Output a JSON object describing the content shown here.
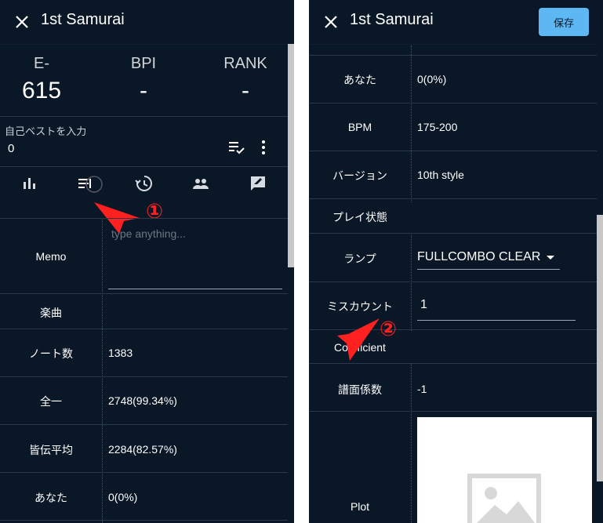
{
  "left": {
    "title": "1st Samurai",
    "stats": [
      {
        "label": "E-",
        "value": "615"
      },
      {
        "label": "BPI",
        "value": "-"
      },
      {
        "label": "RANK",
        "value": "-"
      }
    ],
    "best_label": "自己ベストを入力",
    "best_value": "0",
    "memo": {
      "label": "Memo",
      "placeholder": "type anything..."
    },
    "section": "楽曲",
    "rows": [
      {
        "label": "ノート数",
        "value": "1383"
      },
      {
        "label": "全一",
        "value": "2748(99.34%)"
      },
      {
        "label": "皆伝平均",
        "value": "2284(82.57%)"
      },
      {
        "label": "あなた",
        "value": "0(0%)"
      }
    ],
    "annotation": "①"
  },
  "right": {
    "title": "1st Samurai",
    "save_label": "保存",
    "rows": [
      {
        "label": "あなた",
        "value": "0(0%)"
      },
      {
        "label": "BPM",
        "value": "175-200"
      },
      {
        "label": "バージョン",
        "value": "10th style"
      }
    ],
    "section": "プレイ状態",
    "lamp": {
      "label": "ランプ",
      "value": "FULLCOMBO CLEAR"
    },
    "misscount": {
      "label": "ミスカウント",
      "value": "1"
    },
    "coefficient": "Coefficient",
    "fumen": {
      "label": "譜面係数",
      "value": "-1"
    },
    "plot": "Plot",
    "annotation": "②"
  },
  "colors": {
    "background": "#0a1726",
    "accent": "#5cb7f2",
    "annotation": "#ff2020"
  }
}
